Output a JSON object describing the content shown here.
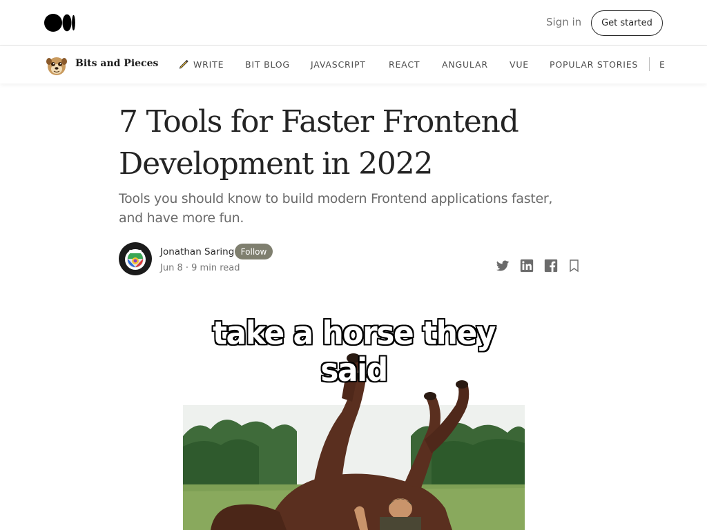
{
  "header": {
    "logo_icon": "medium-logo-icon",
    "signin_label": "Sign in",
    "get_started_label": "Get started"
  },
  "publication": {
    "avatar_icon": "meerkat-avatar-icon",
    "name": "Bits and Pieces",
    "nav": [
      {
        "label": "WRITE",
        "icon": "pencil-icon"
      },
      {
        "label": "BIT BLOG"
      },
      {
        "label": "JAVASCRIPT"
      },
      {
        "label": "REACT"
      },
      {
        "label": "ANGULAR"
      },
      {
        "label": "VUE"
      },
      {
        "label": "POPULAR STORIES"
      },
      {
        "label": "E"
      }
    ]
  },
  "article": {
    "title_line1": "7 Tools for Faster Frontend",
    "title_line2": "Development in 2022",
    "subtitle_line1": "Tools you should know to build modern Frontend applications faster,",
    "subtitle_line2": "and have more fun.",
    "author": {
      "name": "Jonathan Saring",
      "follow_label": "Follow",
      "date": "Jun 8",
      "separator": "·",
      "read_time": "9 min read"
    },
    "share_icons": [
      "twitter-icon",
      "linkedin-icon",
      "facebook-icon",
      "bookmark-icon"
    ],
    "hero_caption": "take a horse they said"
  },
  "colors": {
    "follow_bg": "#7f7f6f",
    "text_primary": "#242424",
    "text_secondary": "#6b6b6b"
  }
}
